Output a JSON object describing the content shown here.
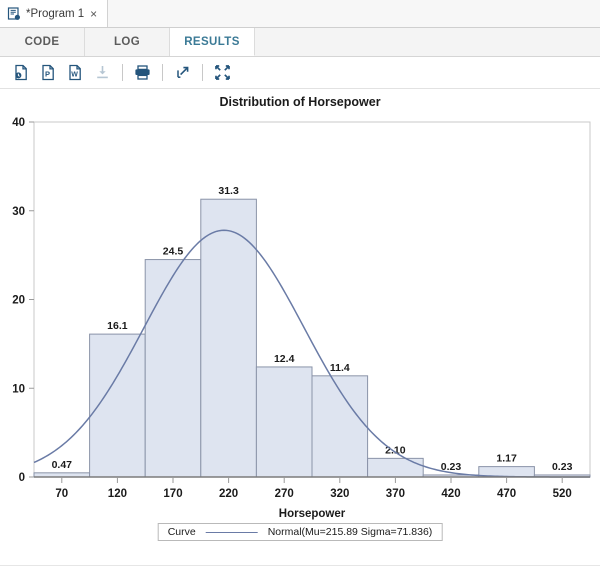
{
  "window": {
    "program_tab": {
      "title": "*Program 1",
      "icon": "sas-program-icon",
      "close": "×"
    }
  },
  "section_tabs": [
    {
      "label": "CODE",
      "active": false
    },
    {
      "label": "LOG",
      "active": false
    },
    {
      "label": "RESULTS",
      "active": true
    }
  ],
  "toolbar": {
    "buttons": [
      {
        "name": "open-html-icon",
        "label": "HTML",
        "glyph": "i",
        "disabled": false
      },
      {
        "name": "open-pdf-icon",
        "label": "PDF",
        "glyph": "P",
        "disabled": false
      },
      {
        "name": "open-word-icon",
        "label": "Word",
        "glyph": "W",
        "disabled": false
      },
      {
        "name": "download-icon",
        "label": "Download",
        "glyph": "↓",
        "disabled": true
      },
      {
        "name": "print-icon",
        "label": "Print",
        "glyph": "⎙",
        "disabled": false
      },
      {
        "name": "open-in-new-window-icon",
        "label": "Open in new window",
        "glyph": "↗",
        "disabled": false
      },
      {
        "name": "collapse-icon",
        "label": "Maximize view",
        "glyph": "⛶",
        "disabled": false
      }
    ]
  },
  "chart_data": {
    "type": "bar",
    "title": "Distribution of Horsepower",
    "xlabel": "Horsepower",
    "ylabel": "",
    "categories": [
      70,
      120,
      170,
      220,
      270,
      320,
      370,
      420,
      470,
      520
    ],
    "values": [
      0.47,
      16.1,
      24.5,
      31.3,
      12.4,
      11.4,
      2.1,
      0.23,
      1.17,
      0.23
    ],
    "bar_labels": [
      "0.47",
      "16.1",
      "24.5",
      "31.3",
      "12.4",
      "11.4",
      "2.10",
      "0.23",
      "1.17",
      "0.23"
    ],
    "xticks": [
      "70",
      "120",
      "170",
      "220",
      "270",
      "320",
      "370",
      "420",
      "470",
      "520"
    ],
    "yticks": [
      "0",
      "10",
      "20",
      "30",
      "40"
    ],
    "ylim": [
      0,
      40
    ],
    "xlim": [
      45,
      545
    ],
    "bin_width": 50,
    "grid": false,
    "legend": {
      "position": "bottom",
      "title": "Curve",
      "entries": [
        {
          "label": "Normal(Mu=215.89 Sigma=71.836)",
          "type": "line",
          "color": "#6a7ba6"
        }
      ]
    },
    "overlay_curve": {
      "distribution": "Normal",
      "mu": 215.89,
      "sigma": 71.836,
      "peak_percent": 27.8,
      "color": "#6a7ba6"
    },
    "colors": {
      "bar_fill": "#dee4f0",
      "bar_stroke": "#8a93a8",
      "curve": "#6a7ba6",
      "axis": "#9a9a9a",
      "text": "#1b1b1b"
    }
  }
}
